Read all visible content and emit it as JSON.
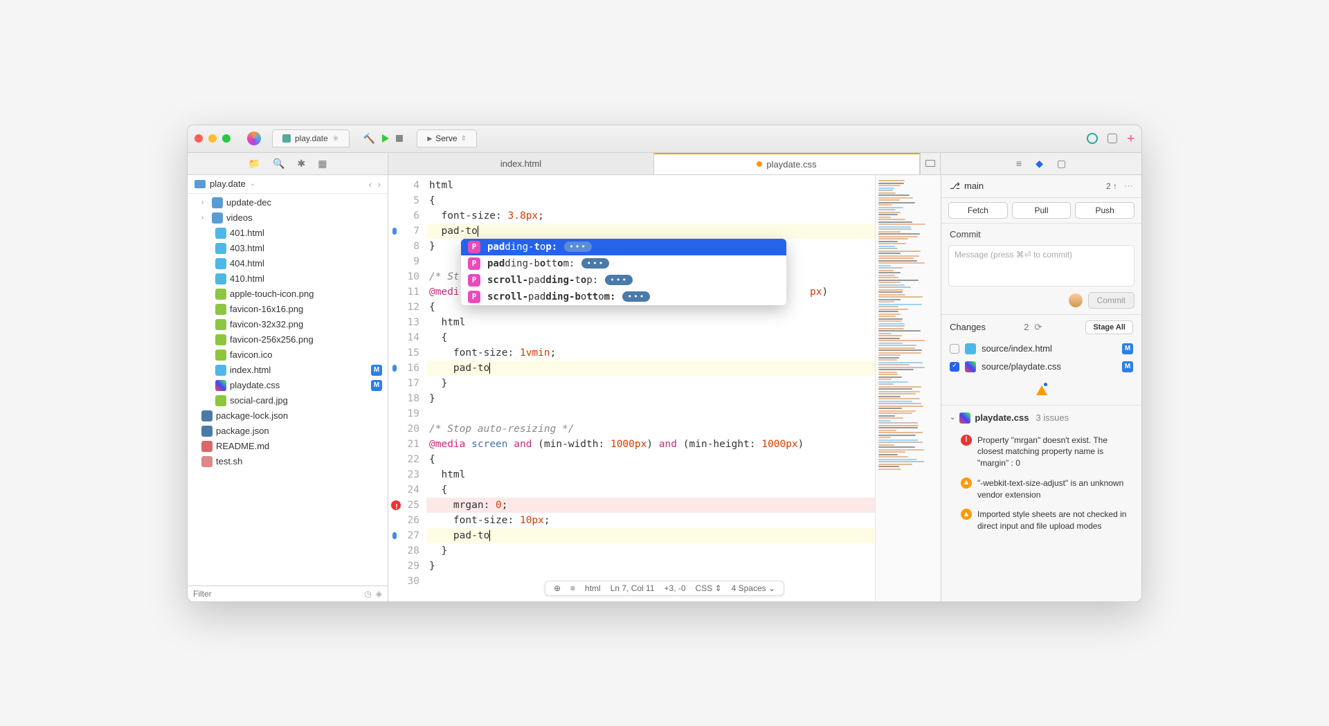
{
  "titlebar": {
    "project_tab": "play.date",
    "serve_label": "Serve"
  },
  "editor_tabs": [
    {
      "label": "index.html",
      "active": false,
      "modified": false
    },
    {
      "label": "playdate.css",
      "active": true,
      "modified": true
    }
  ],
  "project": {
    "root": "play.date",
    "folders": [
      {
        "name": "update-dec"
      },
      {
        "name": "videos"
      }
    ],
    "files": [
      {
        "name": "401.html",
        "type": "html"
      },
      {
        "name": "403.html",
        "type": "html"
      },
      {
        "name": "404.html",
        "type": "html"
      },
      {
        "name": "410.html",
        "type": "html"
      },
      {
        "name": "apple-touch-icon.png",
        "type": "img"
      },
      {
        "name": "favicon-16x16.png",
        "type": "img"
      },
      {
        "name": "favicon-32x32.png",
        "type": "img"
      },
      {
        "name": "favicon-256x256.png",
        "type": "img"
      },
      {
        "name": "favicon.ico",
        "type": "img"
      },
      {
        "name": "index.html",
        "type": "html",
        "badge": "M"
      },
      {
        "name": "playdate.css",
        "type": "css",
        "badge": "M"
      },
      {
        "name": "social-card.jpg",
        "type": "img"
      }
    ],
    "root_files": [
      {
        "name": "package-lock.json",
        "type": "json"
      },
      {
        "name": "package.json",
        "type": "json"
      },
      {
        "name": "README.md",
        "type": "md"
      },
      {
        "name": "test.sh",
        "type": "sh"
      }
    ],
    "filter_placeholder": "Filter"
  },
  "code": {
    "lines": [
      {
        "n": 4,
        "html": "<span class='sel'>html</span>"
      },
      {
        "n": 5,
        "html": "{"
      },
      {
        "n": 6,
        "html": "  <span class='pr'>font-size</span>: <span class='num'>3.8px</span>;"
      },
      {
        "n": 7,
        "html": "  pad-to<span class='cursor'></span>",
        "hl": "yellow",
        "mark": "blue"
      },
      {
        "n": 8,
        "html": "}"
      },
      {
        "n": 9,
        "html": ""
      },
      {
        "n": 10,
        "html": "<span class='cm'>/* St</span>"
      },
      {
        "n": 11,
        "html": "<span class='at'>@medi</span>                                                          <span class='num'>px</span>)"
      },
      {
        "n": 12,
        "html": "{"
      },
      {
        "n": 13,
        "html": "  <span class='sel'>html</span>"
      },
      {
        "n": 14,
        "html": "  {"
      },
      {
        "n": 15,
        "html": "    <span class='pr'>font-size</span>: <span class='num'>1vmin</span>;"
      },
      {
        "n": 16,
        "html": "    pad-to<span class='cursor'></span>",
        "hl": "yellow",
        "mark": "blue"
      },
      {
        "n": 17,
        "html": "  }"
      },
      {
        "n": 18,
        "html": "}"
      },
      {
        "n": 19,
        "html": ""
      },
      {
        "n": 20,
        "html": "<span class='cm'>/* Stop auto-resizing */</span>"
      },
      {
        "n": 21,
        "html": "<span class='at'>@media</span> <span class='fn'>screen</span> <span class='at'>and</span> (<span class='pr'>min-width</span>: <span class='num'>1000px</span>) <span class='at'>and</span> (<span class='pr'>min-height</span>: <span class='num'>1000px</span>)"
      },
      {
        "n": 22,
        "html": "{"
      },
      {
        "n": 23,
        "html": "  <span class='sel'>html</span>"
      },
      {
        "n": 24,
        "html": "  {"
      },
      {
        "n": 25,
        "html": "    mrgan: <span class='num'>0</span>;",
        "hl": "red",
        "mark": "err"
      },
      {
        "n": 26,
        "html": "    <span class='pr'>font-size</span>: <span class='num'>10px</span>;"
      },
      {
        "n": 27,
        "html": "    pad-to<span class='cursor'></span>",
        "hl": "yellow",
        "mark": "blue"
      },
      {
        "n": 28,
        "html": "  }"
      },
      {
        "n": 29,
        "html": "}"
      },
      {
        "n": 30,
        "html": ""
      }
    ]
  },
  "completion": [
    {
      "label_parts": [
        "pad",
        "ding-",
        "t",
        "o",
        "p:"
      ],
      "sel": true
    },
    {
      "label_parts": [
        "pad",
        "ding-b",
        "o",
        "tt",
        "o",
        "m:"
      ]
    },
    {
      "label_parts": [
        "scroll-",
        "pad",
        "ding-",
        "t",
        "o",
        "p:"
      ]
    },
    {
      "label_parts": [
        "scroll-",
        "pad",
        "ding-b",
        "o",
        "tt",
        "o",
        "m:"
      ]
    }
  ],
  "status": {
    "breadcrumb": "html",
    "position": "Ln 7, Col 11",
    "diff": "+3, -0",
    "lang": "CSS",
    "indent": "4 Spaces"
  },
  "git": {
    "branch": "main",
    "ahead": "2 ↑",
    "fetch": "Fetch",
    "pull": "Pull",
    "push": "Push",
    "commit_head": "Commit",
    "commit_placeholder": "Message (press ⌘⏎ to commit)",
    "commit_btn": "Commit",
    "changes_head": "Changes",
    "changes_count": "2",
    "stage_all": "Stage All",
    "changes": [
      {
        "path": "source/index.html",
        "checked": false,
        "type": "html",
        "badge": "M"
      },
      {
        "path": "source/playdate.css",
        "checked": true,
        "type": "css",
        "badge": "M"
      }
    ]
  },
  "issues": {
    "file": "playdate.css",
    "count_label": "3 issues",
    "items": [
      {
        "type": "err",
        "text": "Property \"mrgan\" doesn't exist. The closest matching property name is \"margin\" : 0"
      },
      {
        "type": "warn",
        "text": "\"-webkit-text-size-adjust\" is an unknown vendor extension"
      },
      {
        "type": "warn",
        "text": "Imported style sheets are not checked in direct input and file upload modes"
      }
    ]
  }
}
